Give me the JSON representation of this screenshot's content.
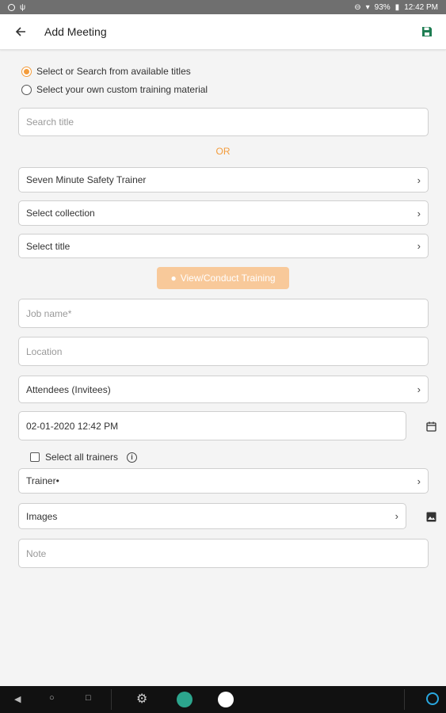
{
  "status": {
    "battery": "93%",
    "time": "12:42 PM"
  },
  "header": {
    "title": "Add Meeting",
    "back_icon": "arrow-left-icon",
    "save_icon": "save-icon"
  },
  "source": {
    "option_search": "Select or Search from available titles",
    "option_custom": "Select your own custom training material",
    "selected": "search"
  },
  "search": {
    "placeholder": "Search title",
    "or_label": "OR"
  },
  "selectors": {
    "trainer_program": "Seven Minute Safety Trainer",
    "collection": "Select collection",
    "title": "Select title"
  },
  "view_button": {
    "label": "View/Conduct Training",
    "icon": "eye-icon"
  },
  "form": {
    "job_name_placeholder": "Job name*",
    "location_placeholder": "Location",
    "attendees": "Attendees (Invitees)",
    "datetime": "02-01-2020 12:42 PM",
    "select_all_trainers": "Select all trainers",
    "trainer": "Trainer•",
    "images": "Images",
    "note_placeholder": "Note"
  },
  "colors": {
    "accent": "#f39c3c",
    "accent_light": "#f8c99a",
    "status_bar": "#6f6f6f"
  }
}
